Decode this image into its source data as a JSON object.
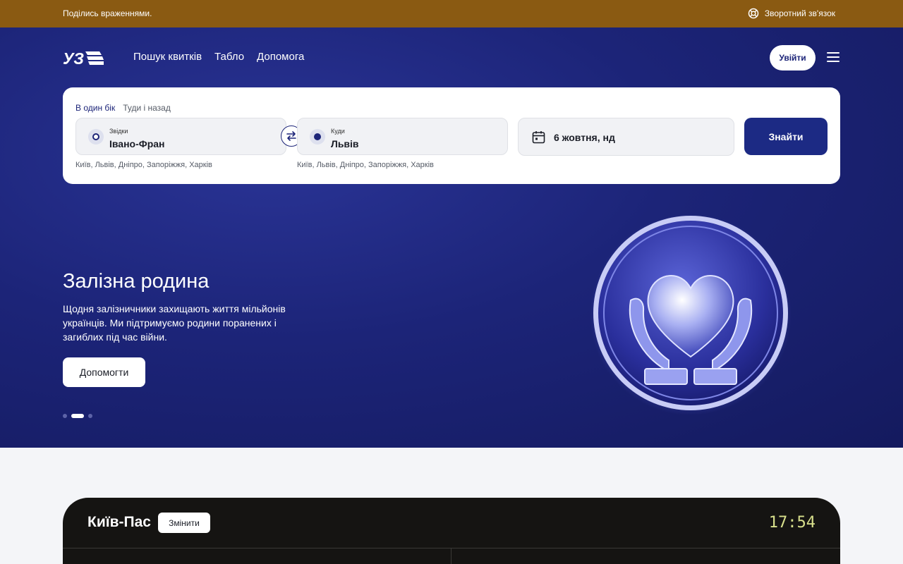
{
  "topbar": {
    "feedback_text": "Поділись враженнями.",
    "support_label": "Зворотний зв'язок",
    "background_color": "#8a5a12",
    "support_icon": "lifebuoy-icon"
  },
  "header": {
    "logo_text": "УЗ",
    "nav": [
      "Пошук квитків",
      "Табло",
      "Допомога"
    ],
    "login_label": "Увійти",
    "menu_icon": "hamburger-menu-icon"
  },
  "search": {
    "trip_types": [
      "В один бік",
      "Туди і назад"
    ],
    "active_trip_type": "В один бік",
    "from": {
      "label": "Звідки",
      "value": "Івано-Фран",
      "suggestions": "Київ, Львів, Дніпро, Запоріжжя, Харків"
    },
    "to": {
      "label": "Куди",
      "value": "Львів",
      "suggestions": "Київ, Львів, Дніпро, Запоріжжя, Харків"
    },
    "date": "6 жовтня, нд",
    "submit_label": "Знайти",
    "accent_color": "#1c2a84"
  },
  "hero": {
    "title": "Залізна родина",
    "text": "Щодня залізничники захищають життя мільйонів українців. Ми підтримуємо родини поранених і загиблих під час війни.",
    "cta_label": "Допомогти",
    "slides_count": 3,
    "active_slide": 2,
    "illustration": "heart-in-hands-medal-icon"
  },
  "board": {
    "station": "Київ-Пас",
    "change_label": "Змінити",
    "time": "17:54"
  }
}
